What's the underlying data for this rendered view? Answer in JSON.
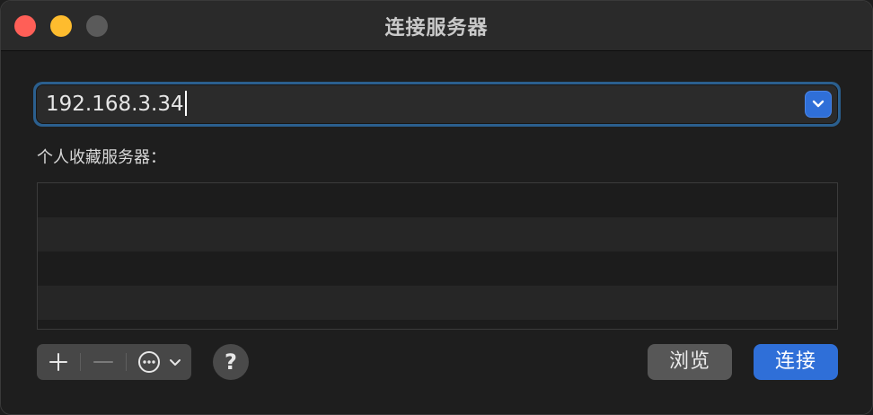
{
  "window": {
    "title": "连接服务器"
  },
  "address": {
    "value": "192.168.3.34"
  },
  "favorites": {
    "label": "个人收藏服务器：",
    "rows": [
      "",
      "",
      "",
      ""
    ]
  },
  "toolbar": {
    "add_icon": "plus-icon",
    "remove_icon": "minus-icon",
    "more_icon": "ellipsis-circle-icon"
  },
  "buttons": {
    "help": "?",
    "browse": "浏览",
    "connect": "连接"
  },
  "colors": {
    "accent": "#2f6fd8",
    "close": "#ff5f57",
    "minimize": "#febc2e",
    "zoom_disabled": "#5a5a5a"
  }
}
